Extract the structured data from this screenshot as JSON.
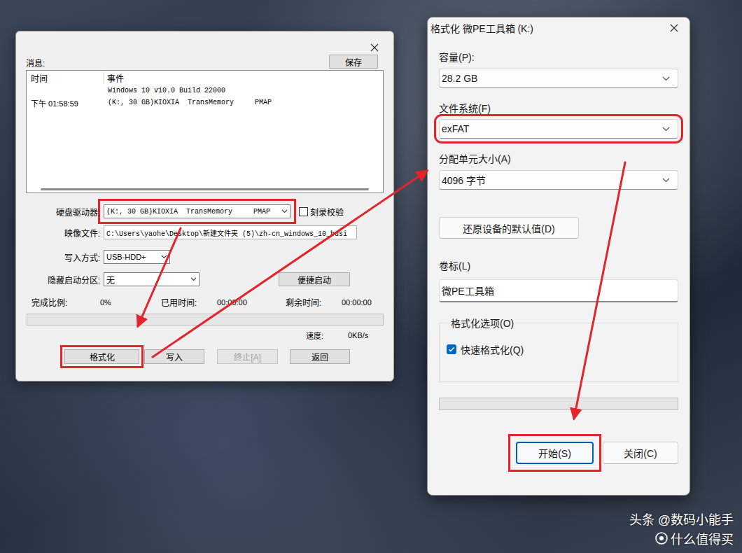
{
  "ultraiso": {
    "messages_label": "消息:",
    "save_button": "保存",
    "log": {
      "columns": [
        "时间",
        "事件"
      ],
      "rows": [
        [
          "",
          "Windows 10 v10.0 Build 22000"
        ],
        [
          "下午 01:58:59",
          "(K:, 30 GB)KIOXIA  TransMemory     PMAP"
        ]
      ]
    },
    "drive": {
      "label": "硬盘驱动器:",
      "value": "(K:, 30 GB)KIOXIA  TransMemory     PMAP",
      "highlighted": true,
      "verify": {
        "label": "刻录校验",
        "checked": false
      }
    },
    "image": {
      "label": "映像文件:",
      "value": "C:\\Users\\yaohe\\Desktop\\新建文件夹 (5)\\zh-cn_windows_10_busi"
    },
    "write_mode": {
      "label": "写入方式:",
      "value": "USB-HDD+"
    },
    "hidden_partition": {
      "label": "隐藏启动分区:",
      "value": "无"
    },
    "quick_boot_button": "便捷启动",
    "stats": [
      {
        "label": "完成比例:",
        "value": "0%"
      },
      {
        "label": "已用时间:",
        "value": "00:00:00"
      },
      {
        "label": "剩余时间:",
        "value": "00:00:00"
      }
    ],
    "progress": {
      "level": 0
    },
    "speed": {
      "label": "速度:",
      "value": "0KB/s"
    },
    "buttons": [
      {
        "label": "格式化",
        "disabled": false,
        "highlighted": true
      },
      {
        "label": "写入",
        "disabled": false,
        "highlighted": false
      },
      {
        "label": "终止[A]",
        "disabled": true,
        "highlighted": false
      },
      {
        "label": "返回",
        "disabled": false,
        "highlighted": false
      }
    ]
  },
  "format_dialog": {
    "title": "格式化 微PE工具箱 (K:)",
    "fields": [
      {
        "label": "容量(P):",
        "value": "28.2 GB",
        "highlighted": false
      },
      {
        "label": "文件系统(F)",
        "value": "exFAT",
        "highlighted": true
      },
      {
        "label": "分配单元大小(A)",
        "value": "4096 字节",
        "highlighted": false
      }
    ],
    "restore_button": "还原设备的默认值(D)",
    "volume_label": {
      "label": "卷标(L)",
      "value": "微PE工具箱"
    },
    "options": {
      "title": "格式化选项(O)",
      "quick_format": {
        "label": "快速格式化(Q)",
        "checked": true
      }
    },
    "progress": {
      "level": 0
    },
    "buttons": [
      {
        "label": "开始(S)",
        "default": true,
        "highlighted": true
      },
      {
        "label": "关闭(C)",
        "default": false,
        "highlighted": false
      }
    ]
  },
  "watermark": [
    "头条 @数码小能手",
    "什么值得买"
  ]
}
